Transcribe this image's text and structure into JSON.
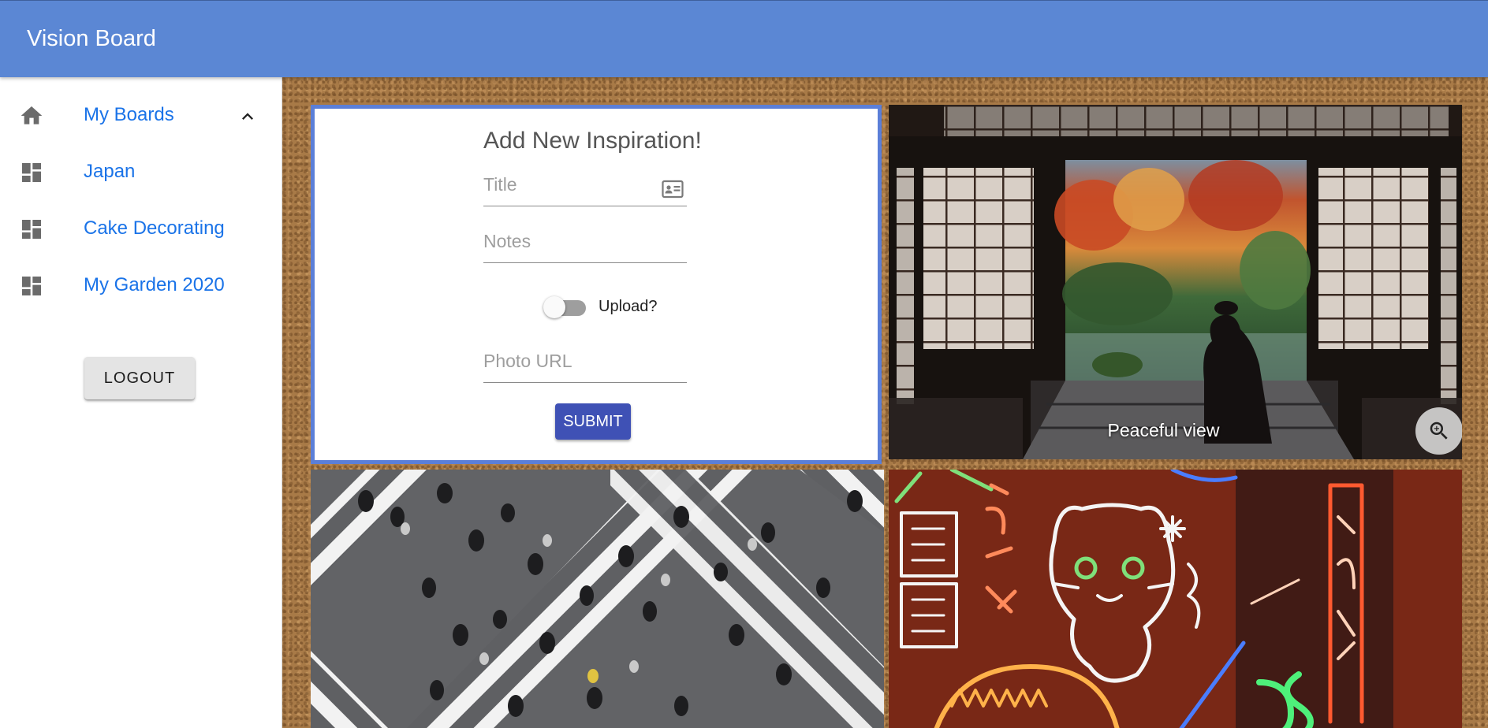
{
  "app": {
    "title": "Vision Board"
  },
  "sidebar": {
    "items": [
      {
        "label": "My Boards",
        "icon": "home-icon",
        "expanded": true
      },
      {
        "label": "Japan",
        "icon": "dashboard-icon"
      },
      {
        "label": "Cake Decorating",
        "icon": "dashboard-icon"
      },
      {
        "label": "My Garden 2020",
        "icon": "dashboard-icon"
      }
    ],
    "logout_label": "LOGOUT"
  },
  "form": {
    "heading": "Add New Inspiration!",
    "title_placeholder": "Title",
    "notes_placeholder": "Notes",
    "upload_label": "Upload?",
    "upload_enabled": false,
    "photo_url_placeholder": "Photo URL",
    "submit_label": "SUBMIT"
  },
  "tiles": [
    {
      "caption": "Peaceful view",
      "image": "japanese-garden-photo"
    },
    {
      "image": "crosswalk-crowd-photo"
    },
    {
      "image": "neon-cat-sign-photo"
    }
  ],
  "colors": {
    "appbar": "#5b87d4",
    "link": "#1a73e8",
    "submit": "#3f51b5",
    "form_border": "#5b7fd8",
    "cork": "#a87a47"
  }
}
